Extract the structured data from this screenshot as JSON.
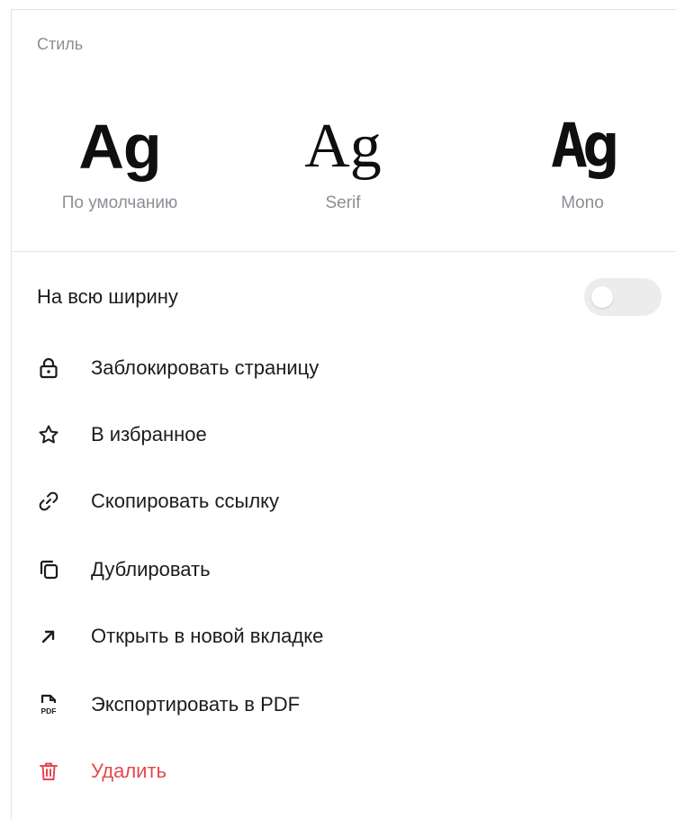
{
  "style_section": {
    "label": "Стиль",
    "options": [
      {
        "glyph": "Ag",
        "caption": "По умолчанию"
      },
      {
        "glyph": "Ag",
        "caption": "Serif"
      },
      {
        "glyph": "Ag",
        "caption": "Mono"
      }
    ]
  },
  "full_width": {
    "label": "На всю ширину",
    "enabled": false
  },
  "menu": {
    "items": [
      {
        "label": "Заблокировать страницу",
        "icon": "lock-icon"
      },
      {
        "label": "В избранное",
        "icon": "star-icon"
      },
      {
        "label": "Скопировать ссылку",
        "icon": "link-icon"
      },
      {
        "label": "Дублировать",
        "icon": "duplicate-icon"
      },
      {
        "label": "Открыть в новой вкладке",
        "icon": "arrow-up-right-icon"
      },
      {
        "label": "Экспортировать в PDF",
        "icon": "pdf-file-icon",
        "icon_text": "PDF"
      },
      {
        "label": "Удалить",
        "icon": "trash-icon"
      }
    ]
  },
  "colors": {
    "text": "#1c1c1c",
    "muted": "#8b8f95",
    "danger": "#e5484d",
    "toggle_off": "#ececec"
  }
}
